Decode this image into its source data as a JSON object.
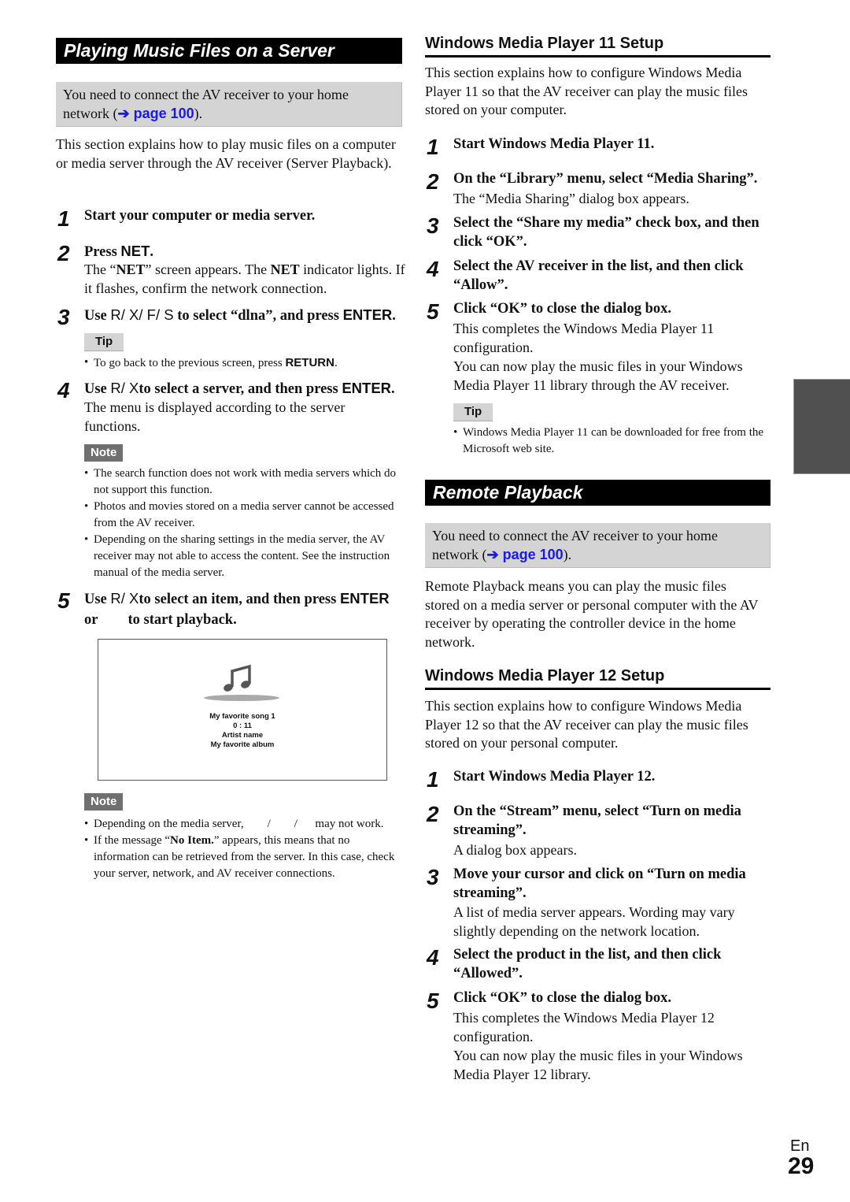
{
  "left": {
    "banner": "Playing Music Files on a Server",
    "prereq": {
      "text": "You need to connect the AV receiver to your home network (",
      "link": "➔ page 100",
      "end": ")."
    },
    "intro": "This section explains how to play music files on a computer or media server through the AV receiver (Server Playback).",
    "steps": [
      {
        "num": "1",
        "head": "Start your computer or media server."
      },
      {
        "num": "2",
        "head_pre": "Press ",
        "head_key": "NET",
        "head_post": ".",
        "body_pre": "The “",
        "body_b1": "NET",
        "body_mid": "” screen appears. The ",
        "body_b2": "NET",
        "body_post": " indicator lights. If it flashes, confirm the network connection."
      },
      {
        "num": "3",
        "head_pre": "Use ",
        "head_keys": "R/ X/ F/ S",
        "head_mid": " to select “dlna”, and press ",
        "head_key": "ENTER",
        "head_post": "."
      },
      {
        "num": "4",
        "head_pre": "Use ",
        "head_keys": "R/ X",
        "head_mid": "to select a server, and then press ",
        "head_key": "ENTER",
        "head_post": ".",
        "body": "The menu is displayed according to the server functions."
      },
      {
        "num": "5",
        "head_pre": "Use ",
        "head_keys": "R/ X",
        "head_mid": "to select an item, and then press ",
        "head_key": "ENTER",
        "head_line2_pre": "or",
        "head_line2_post": "to start playback."
      }
    ],
    "tip1": {
      "label": "Tip",
      "pre": "To go back to the previous screen, press ",
      "key": "RETURN",
      "post": "."
    },
    "note1": {
      "label": "Note",
      "items": [
        "The search function does not work with media servers which do not support this function.",
        "Photos and movies stored on a media server cannot be accessed from the AV receiver.",
        "Depending on the sharing settings in the media server, the AV receiver may not able to access the content. See the instruction manual of the media server."
      ]
    },
    "screen": {
      "icon": "music-note-icon",
      "song": "My favorite song 1",
      "time": "0 : 11",
      "artist": "Artist name",
      "album": "My favorite album"
    },
    "note2": {
      "label": "Note",
      "item1": "Depending on the media server,        /        /      may not work.",
      "item2_pre": "If the message “",
      "item2_b": "No Item.",
      "item2_post": "” appears, this means that no information can be retrieved from the server. In this case, check your server, network, and AV receiver connections."
    }
  },
  "right": {
    "wmp11": {
      "heading": "Windows Media Player 11 Setup",
      "intro": "This section explains how to configure Windows Media Player 11 so that the AV receiver can play the music files stored on your computer.",
      "steps": [
        {
          "num": "1",
          "head": "Start Windows Media Player 11."
        },
        {
          "num": "2",
          "head": "On the “Library” menu, select “Media Sharing”.",
          "body": "The “Media Sharing” dialog box appears."
        },
        {
          "num": "3",
          "head": "Select the “Share my media” check box, and then click “OK”."
        },
        {
          "num": "4",
          "head": "Select the AV receiver in the list, and then click “Allow”."
        },
        {
          "num": "5",
          "head": "Click “OK” to close the dialog box.",
          "body1": "This completes the Windows Media Player 11 configuration.",
          "body2": "You can now play the music files in your Windows Media Player 11 library through the AV receiver."
        }
      ],
      "tip": {
        "label": "Tip",
        "text": "Windows Media Player 11 can be downloaded for free from the Microsoft web site."
      }
    },
    "remote": {
      "banner": "Remote Playback",
      "prereq": {
        "text": "You need to connect the AV receiver to your home network (",
        "link": "➔ page 100",
        "end": ")."
      },
      "intro": "Remote Playback means you can play the music files stored on a media server or personal computer with the AV receiver by operating the controller device in the home network."
    },
    "wmp12": {
      "heading": "Windows Media Player 12 Setup",
      "intro": "This section explains how to configure Windows Media Player 12 so that the AV receiver can play the music files stored on your personal computer.",
      "steps": [
        {
          "num": "1",
          "head": "Start Windows Media Player 12."
        },
        {
          "num": "2",
          "head": "On the “Stream” menu, select “Turn on media streaming”.",
          "body": "A dialog box appears."
        },
        {
          "num": "3",
          "head": "Move your cursor and click on “Turn on media streaming”.",
          "body": "A list of media server appears. Wording may vary slightly depending on the network location."
        },
        {
          "num": "4",
          "head": "Select the product in the list, and then click “Allowed”."
        },
        {
          "num": "5",
          "head": "Click “OK” to close the dialog box.",
          "body1": "This completes the Windows Media Player 12 configuration.",
          "body2": "You can now play the music files in your Windows Media Player 12 library."
        }
      ]
    }
  },
  "footer": {
    "lang": "En",
    "page": "29"
  },
  "colors": {
    "link": "#1a1ae6",
    "banner_bg": "#000000",
    "prereq_bg": "#d4d4d4",
    "note_bg": "#707070",
    "tab_bg": "#505050"
  }
}
